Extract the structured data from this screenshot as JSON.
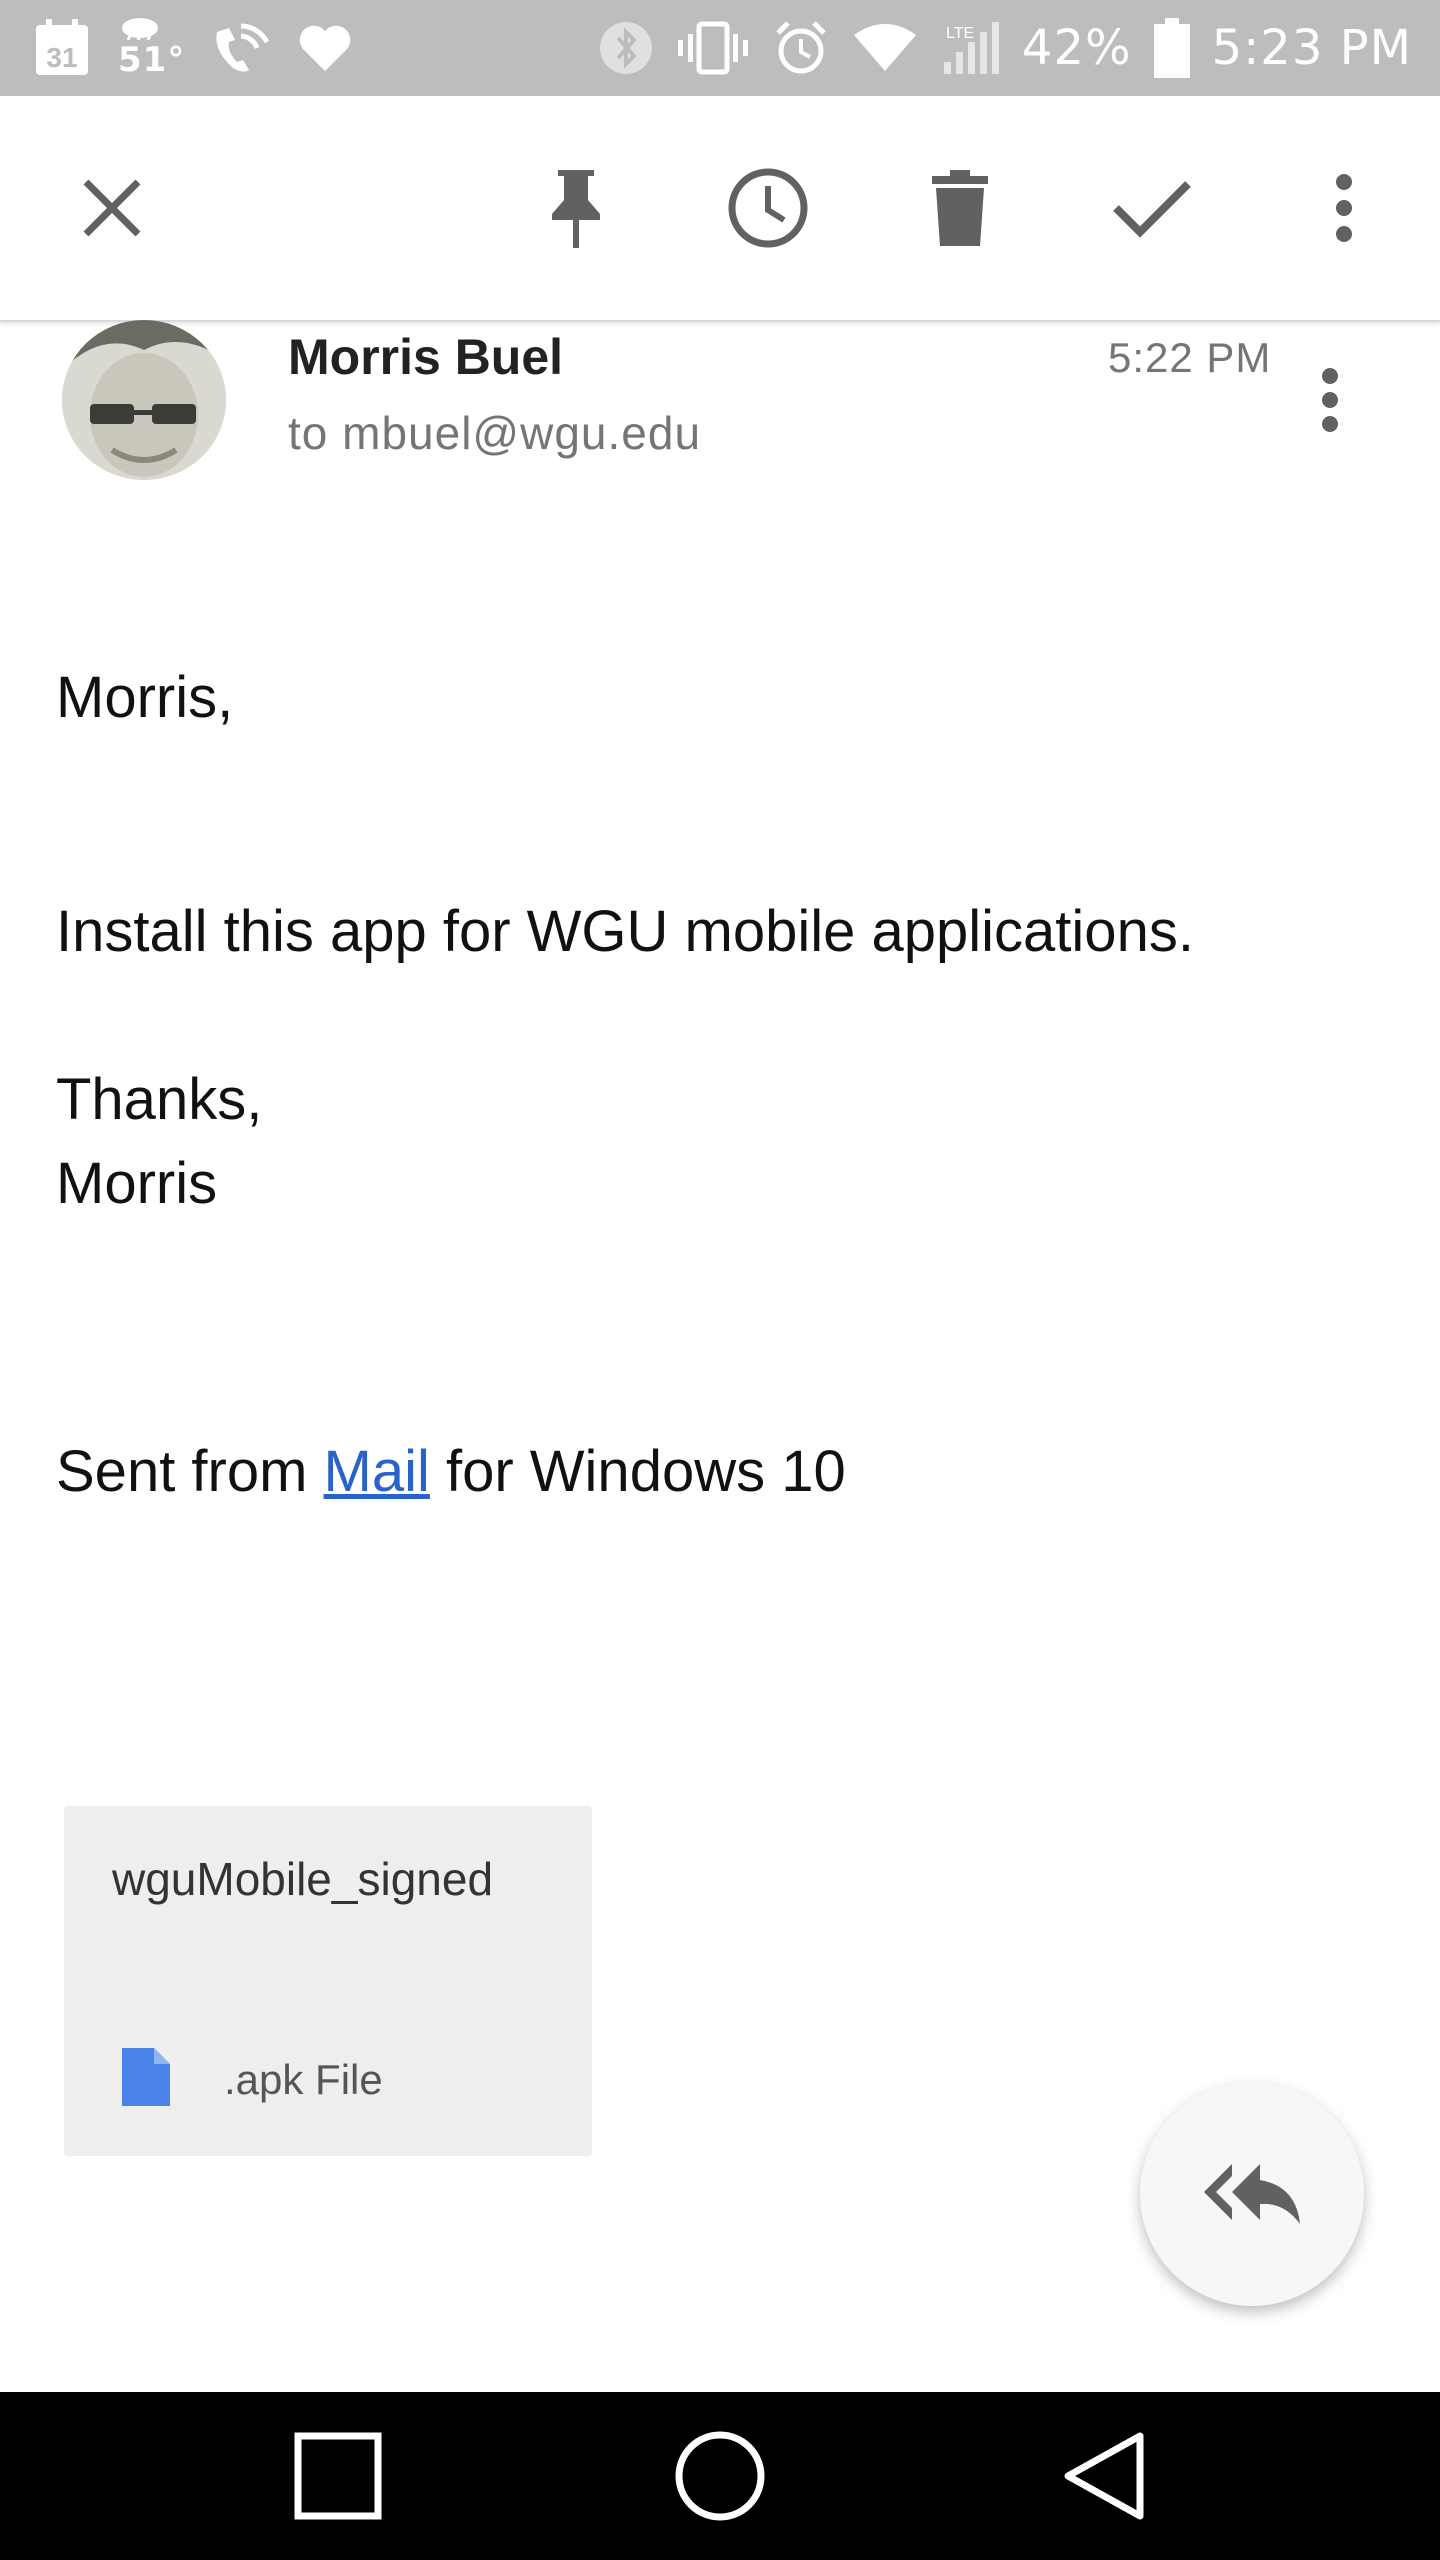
{
  "status_bar": {
    "calendar_day": "31",
    "temperature": "51°",
    "battery": "42%",
    "time": "5:23 PM",
    "icons": [
      "calendar-icon",
      "weather-icon",
      "wifi-calling-icon",
      "heart-icon",
      "bluetooth-icon",
      "vibrate-icon",
      "alarm-icon",
      "wifi-icon",
      "signal-icon",
      "battery-icon"
    ]
  },
  "toolbar": {
    "actions": [
      "close-icon",
      "pin-icon",
      "snooze-icon",
      "delete-icon",
      "done-icon",
      "more-vert-icon"
    ]
  },
  "message": {
    "sender": "Morris Buel",
    "recipient": "to mbuel@wgu.edu",
    "time": "5:22 PM",
    "greeting": "Morris,",
    "line1": "Install this app for WGU mobile applications.",
    "signoff1": "Thanks,",
    "signoff2": "Morris",
    "sent_prefix": "Sent from ",
    "sent_link": "Mail",
    "sent_suffix": " for Windows 10"
  },
  "attachment": {
    "name": "wguMobile_signed",
    "type": ".apk File",
    "icon": "file-icon",
    "icon_color": "#4a84e8"
  },
  "fab": {
    "icon": "reply-all-icon"
  },
  "nav": {
    "icons": [
      "recents-icon",
      "home-icon",
      "back-icon"
    ]
  },
  "colors": {
    "status_bar": "#bdbdbd",
    "link": "#2962c9",
    "attachment_bg": "#eeeeee",
    "nav_bar": "#000000"
  }
}
